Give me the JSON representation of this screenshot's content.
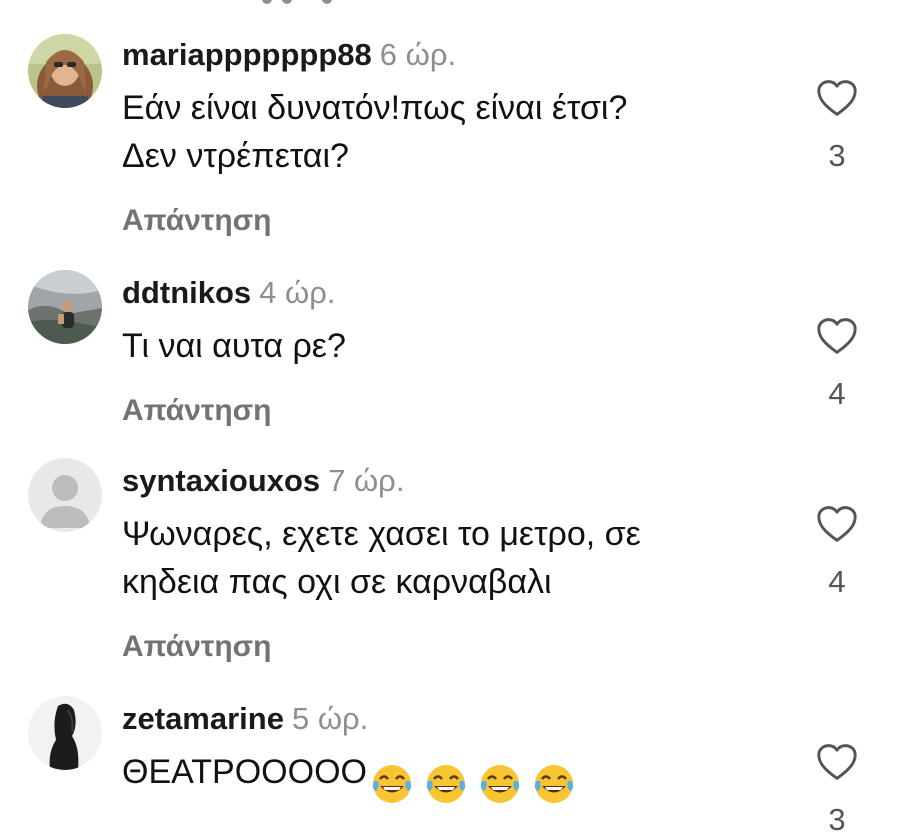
{
  "comments": [
    {
      "username": "mariappppppp88",
      "time": "6 ώρ.",
      "text_lines": [
        "Εάν είναι δυνατόν!πως είναι έτσι?",
        "Δεν ντρέπεται?"
      ],
      "reply_label": "Απάντηση",
      "likes": "3",
      "avatar": "profile-photo"
    },
    {
      "username": "ddtnikos",
      "time": "4 ώρ.",
      "text_lines": [
        "Τι ναι αυτα ρε?"
      ],
      "reply_label": "Απάντηση",
      "likes": "4",
      "avatar": "profile-photo"
    },
    {
      "username": "syntaxiouxos",
      "time": "7 ώρ.",
      "text_lines": [
        "Ψωναρες, εχετε χασει το μετρο, σε",
        "κηδεια πας οχι σε καρναβαλι"
      ],
      "reply_label": "Απάντηση",
      "likes": "4",
      "avatar": "default-user-icon"
    },
    {
      "username": "zetamarine",
      "time": "5 ώρ.",
      "text_lines": [
        "ΘΕΑΤΡΟΟΟΟΟ"
      ],
      "emoji": [
        "face-with-tears-of-joy",
        "face-with-tears-of-joy",
        "face-with-tears-of-joy",
        "face-with-tears-of-joy"
      ],
      "likes": "3",
      "avatar": "profile-photo"
    }
  ],
  "icons": {
    "like": "heart-outline-icon"
  },
  "colors": {
    "secondary_text": "#8e8e8e",
    "reply_text": "#737373",
    "emoji_face": "#f7c531"
  }
}
